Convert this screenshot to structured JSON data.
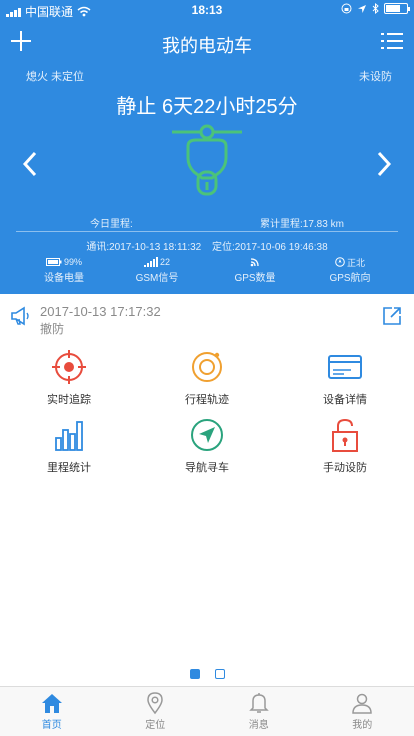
{
  "status_bar": {
    "carrier": "中国联通",
    "time": "18:13"
  },
  "nav": {
    "title": "我的电动车"
  },
  "hero": {
    "location_status": "熄火 未定位",
    "defense_status": "未设防",
    "state_duration": "静止 6天22小时25分",
    "today_mileage": "今日里程:",
    "total_mileage": "累计里程:17.83 km",
    "comm_time": "通讯:2017-10-13 18:11:32",
    "locate_time": "定位:2017-10-06 19:46:38",
    "stats": {
      "battery_value": "99%",
      "battery_label": "设备电量",
      "gsm_value": "22",
      "gsm_label": "GSM信号",
      "gps_count_label": "GPS数量",
      "heading_value": "正北",
      "heading_label": "GPS航向"
    }
  },
  "notice": {
    "date": "2017-10-13 17:17:32",
    "state": "撤防"
  },
  "grid": [
    {
      "label": "实时追踪",
      "icon": "target-icon"
    },
    {
      "label": "行程轨迹",
      "icon": "track-icon"
    },
    {
      "label": "设备详情",
      "icon": "card-icon"
    },
    {
      "label": "里程统计",
      "icon": "bar-chart-icon"
    },
    {
      "label": "导航寻车",
      "icon": "navigation-icon"
    },
    {
      "label": "手动设防",
      "icon": "lock-icon"
    }
  ],
  "tabs": [
    {
      "label": "首页",
      "icon": "home-icon"
    },
    {
      "label": "定位",
      "icon": "location-icon"
    },
    {
      "label": "消息",
      "icon": "bell-icon"
    },
    {
      "label": "我的",
      "icon": "user-icon"
    }
  ],
  "colors": {
    "primary": "#2f8ae0",
    "scooter_green": "#4bc37a",
    "target_red": "#e84c3d",
    "track_orange": "#f0a030",
    "grid_blue": "#2f8ae0",
    "nav_teal": "#2aa37d"
  },
  "pager": {
    "pages": 2,
    "active": 1
  }
}
